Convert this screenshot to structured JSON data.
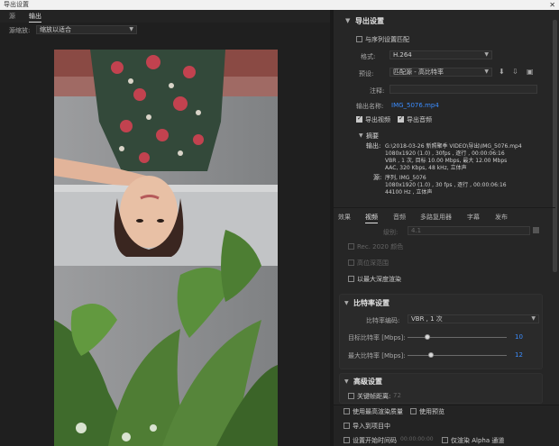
{
  "window": {
    "title": "导出设置"
  },
  "left_panel": {
    "tabs": [
      "源",
      "输出"
    ],
    "scale_label": "源缩放:",
    "scale_value": "缩放以适合"
  },
  "export_settings": {
    "section_title": "导出设置",
    "match_sequence_label": "与序列设置匹配",
    "format_label": "格式:",
    "format_value": "H.264",
    "preset_label": "预设:",
    "preset_value": "匹配源 - 高比特率",
    "comment_label": "注释:",
    "output_name_label": "输出名称:",
    "output_name_value": "IMG_5076.mp4",
    "export_video_label": "导出视频",
    "export_audio_label": "导出音频"
  },
  "summary": {
    "title": "摘要",
    "output_label": "输出:",
    "output_lines": [
      "G:\\2018-03-26  新照聚季 VIDEO\\导出\\IMG_5076.mp4",
      "1080x1920 (1.0) , 30fps , 逐行 , 00:00:06:16",
      "VBR , 1 次, 目标 10.00 Mbps, 最大 12.00 Mbps",
      "AAC, 320 Kbps, 48 kHz, 立体声"
    ],
    "source_label": "源:",
    "source_lines": [
      "序列, IMG_5076",
      "1080x1920 (1.0) , 30 fps , 逐行 , 00:00:06:16",
      "44100 Hz , 立体声"
    ]
  },
  "settings_tabs": [
    "效果",
    "视频",
    "音频",
    "多路复用器",
    "字幕",
    "发布"
  ],
  "video": {
    "level_label": "级别:",
    "level_value": "4.1",
    "rec2020_label": "Rec. 2020 颜色",
    "high_bit_depth_label": "高位深范围",
    "max_depth_label": "以最大深度渲染"
  },
  "bitrate": {
    "section_title": "比特率设置",
    "encoding_label": "比特率编码:",
    "encoding_value": "VBR , 1 次",
    "target_label": "目标比特率 [Mbps]:",
    "target_value": "10",
    "target_fraction": 0.2,
    "max_label": "最大比特率 [Mbps]:",
    "max_value": "12",
    "max_fraction": 0.24
  },
  "advanced": {
    "section_title": "高级设置",
    "keyframe_label": "关键帧距离:",
    "keyframe_value": "72"
  },
  "bottom_options": {
    "max_render_quality": "使用最高渲染质量",
    "use_previews": "使用预览",
    "import_into_project": "导入到项目中",
    "set_start_timecode": "设置开始时间码",
    "start_timecode_value": "00:00:00:00",
    "render_alpha_only": "仅渲染 Alpha 通道"
  },
  "colors": {
    "accent_blue": "#3b8dff",
    "panel_bg": "#262626",
    "left_bg": "#1f1f1f"
  }
}
